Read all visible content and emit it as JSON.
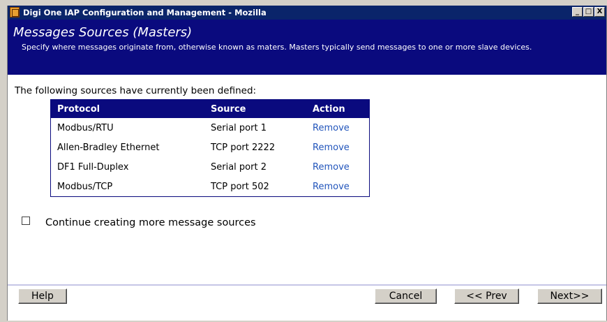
{
  "window": {
    "title": "Digi One IAP Configuration and Management - Mozilla",
    "minimize": "_",
    "maximize": "□",
    "close": "X"
  },
  "header": {
    "title": "Messages Sources (Masters)",
    "description": "Specify where messages originate from, otherwise known as maters. Masters typically send messages to one or more slave devices."
  },
  "main": {
    "intro": "The following sources have currently been defined:",
    "table": {
      "headers": [
        "Protocol",
        "Source",
        "Action"
      ],
      "rows": [
        {
          "protocol": "Modbus/RTU",
          "source": "Serial port 1",
          "action": "Remove"
        },
        {
          "protocol": "Allen-Bradley Ethernet",
          "source": "TCP port 2222",
          "action": "Remove"
        },
        {
          "protocol": "DF1 Full-Duplex",
          "source": "Serial port 2",
          "action": "Remove"
        },
        {
          "protocol": "Modbus/TCP",
          "source": "TCP port 502",
          "action": "Remove"
        }
      ]
    },
    "continue_checkbox": {
      "label": "Continue creating more message sources",
      "checked": false
    }
  },
  "footer": {
    "help": "Help",
    "cancel": "Cancel",
    "prev": "<< Prev",
    "next": "Next>>"
  },
  "colors": {
    "header_bg": "#0a0a7e",
    "titlebar_bg": "#0a246a",
    "link": "#2255bb"
  }
}
